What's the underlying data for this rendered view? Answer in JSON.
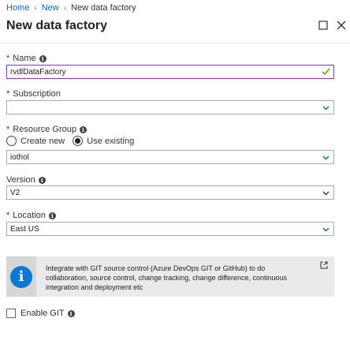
{
  "breadcrumb": {
    "home": "Home",
    "new": "New",
    "current": "New data factory"
  },
  "header": {
    "title": "New data factory"
  },
  "form": {
    "name": {
      "label": "Name",
      "value": "rvdlDataFactory"
    },
    "subscription": {
      "label": "Subscription",
      "value": ""
    },
    "resource_group": {
      "label": "Resource Group",
      "option_create": "Create new",
      "option_existing": "Use existing",
      "selected": "Use existing",
      "value": "iothol"
    },
    "version": {
      "label": "Version",
      "value": "V2"
    },
    "location": {
      "label": "Location",
      "value": "East US"
    }
  },
  "git_info": {
    "text": "Integrate with GIT source control (Azure DevOps GIT or GitHub) to do collaboration, source control, change tracking, change difference, continuous integration and deployment etc"
  },
  "enable_git": {
    "label": "Enable GIT",
    "checked": false
  },
  "colors": {
    "link": "#0066b8",
    "required": "#cc0000",
    "info_blue": "#0a78d4",
    "focus_border": "#8a3aa6",
    "valid_check": "#57a300"
  },
  "icons": [
    "info-icon",
    "check-icon",
    "chevron-down-icon",
    "maximize-icon",
    "close-icon",
    "external-link-icon"
  ]
}
